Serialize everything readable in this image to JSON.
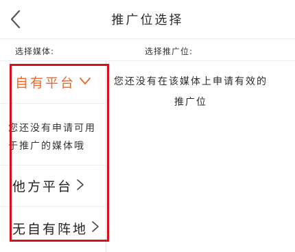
{
  "header": {
    "title": "推广位选择",
    "back_icon": "chevron-left-icon"
  },
  "columns": {
    "left_label": "选择媒体:",
    "right_label": "选择推广位:"
  },
  "sidebar": {
    "items": [
      {
        "label": "自有平台",
        "icon": "chevron-down-icon",
        "active": true,
        "color": "#f0641e"
      },
      {
        "label": "您还没有申请可用于推广的媒体哦",
        "type": "hint"
      },
      {
        "label": "他方平台",
        "icon": "chevron-right-icon"
      },
      {
        "label": "无自有阵地",
        "icon": "chevron-right-icon"
      }
    ]
  },
  "main": {
    "empty_message": "您还没有在该媒体上申请有效的推广位"
  },
  "colors": {
    "accent": "#f0641e",
    "annotation": "#d6101c"
  }
}
